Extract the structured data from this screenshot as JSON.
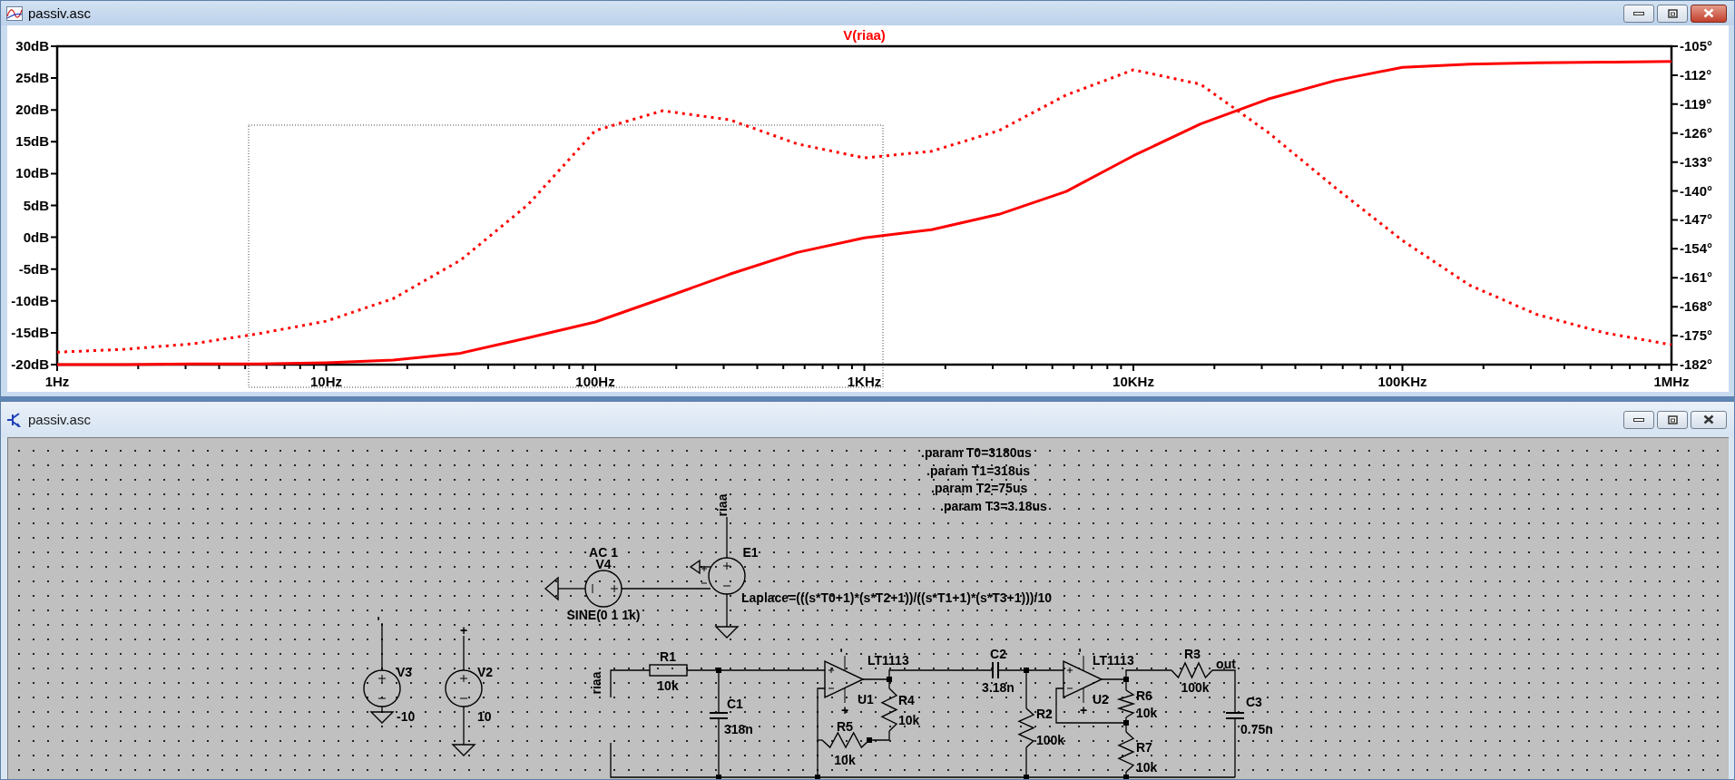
{
  "windows": [
    {
      "kind": "waveform",
      "title": "passiv.asc",
      "active": true,
      "plot": {
        "chart_data": {
          "type": "line",
          "title": "V(riaa)",
          "categories": [
            "1Hz",
            null,
            null,
            null,
            "10Hz",
            null,
            null,
            null,
            "100Hz",
            null,
            null,
            null,
            "1KHz",
            null,
            null,
            null,
            "10KHz",
            null,
            null,
            null,
            "100KHz",
            null,
            null,
            null,
            "1MHz"
          ],
          "ylim": [
            -20,
            30
          ],
          "y2lim": [
            -182,
            -105
          ],
          "yticks": [
            {
              "value": 30,
              "label": "30dB"
            },
            {
              "value": 25,
              "label": "25dB"
            },
            {
              "value": 20,
              "label": "20dB"
            },
            {
              "value": 15,
              "label": "15dB"
            },
            {
              "value": 10,
              "label": "10dB"
            },
            {
              "value": 5,
              "label": "5dB"
            },
            {
              "value": 0,
              "label": "0dB"
            },
            {
              "value": -5,
              "label": "-5dB"
            },
            {
              "value": -10,
              "label": "-10dB"
            },
            {
              "value": -15,
              "label": "-15dB"
            },
            {
              "value": -20,
              "label": "-20dB"
            }
          ],
          "y2ticks": [
            {
              "value": -105,
              "label": "-105°"
            },
            {
              "value": -112,
              "label": "-112°"
            },
            {
              "value": -119,
              "label": "-119°"
            },
            {
              "value": -126,
              "label": "-126°"
            },
            {
              "value": -133,
              "label": "-133°"
            },
            {
              "value": -140,
              "label": "-140°"
            },
            {
              "value": -147,
              "label": "-147°"
            },
            {
              "value": -154,
              "label": "-154°"
            },
            {
              "value": -161,
              "label": "-161°"
            },
            {
              "value": -168,
              "label": "-168°"
            },
            {
              "value": -175,
              "label": "-175°"
            },
            {
              "value": -182,
              "label": "-182°"
            }
          ],
          "series": [
            {
              "color": "#ff0000",
              "line_style": "solid",
              "values": [
                -20,
                -20,
                -19.9,
                -19.9,
                -19.7,
                -19.3,
                -18.2,
                -15.8,
                -13.3,
                -9.6,
                -5.8,
                -2.4,
                -0.1,
                1.2,
                3.6,
                7.2,
                12.8,
                17.8,
                21.7,
                24.6,
                26.7,
                27.2,
                27.4,
                27.5,
                27.6
              ]
            },
            {
              "axis": "y2",
              "color": "#ff0000",
              "line_style": "dotted",
              "values": [
                -179,
                -178.3,
                -177,
                -174.5,
                -171.5,
                -166,
                -156.7,
                -143.3,
                -125.4,
                -120.6,
                -122.8,
                -128.6,
                -132,
                -130.4,
                -125.4,
                -116.8,
                -110.7,
                -114.2,
                -125.8,
                -139.2,
                -152,
                -162.8,
                -169.9,
                -174.3,
                -177.2
              ]
            }
          ]
        }
      }
    },
    {
      "kind": "schematic",
      "title": "passiv.asc",
      "active": false,
      "schematic": {
        "directives": [
          ".param T0=3180us",
          ".param T1=318us",
          ".param T2=75us",
          ".param T3=3.18us"
        ],
        "components": [
          {
            "kind": "voltage_source",
            "ref": "V4",
            "value": "SINE(0 1 1k)",
            "extra": "AC 1"
          },
          {
            "kind": "dependent_source",
            "ref": "E1",
            "value": "Laplace=(((s*T0+1)*(s*T2+1))/((s*T1+1)*(s*T3+1)))/10"
          },
          {
            "kind": "voltage_source",
            "ref": "V3",
            "value": "-10"
          },
          {
            "kind": "voltage_source",
            "ref": "V2",
            "value": "10"
          },
          {
            "kind": "resistor",
            "ref": "R1",
            "value": "10k"
          },
          {
            "kind": "capacitor",
            "ref": "C1",
            "value": "318n"
          },
          {
            "kind": "opamp",
            "ref": "U1",
            "value": "LT1113"
          },
          {
            "kind": "resistor",
            "ref": "R4",
            "value": "10k"
          },
          {
            "kind": "resistor",
            "ref": "R5",
            "value": "10k"
          },
          {
            "kind": "capacitor",
            "ref": "C2",
            "value": "3.18n"
          },
          {
            "kind": "resistor",
            "ref": "R2",
            "value": "100k"
          },
          {
            "kind": "opamp",
            "ref": "U2",
            "value": "LT1113"
          },
          {
            "kind": "resistor",
            "ref": "R6",
            "value": "10k"
          },
          {
            "kind": "resistor",
            "ref": "R7",
            "value": "10k"
          },
          {
            "kind": "resistor",
            "ref": "R3",
            "value": "100k"
          },
          {
            "kind": "capacitor",
            "ref": "C3",
            "value": "0.75n"
          }
        ],
        "net_labels": [
          "riaa",
          "riaa",
          "out",
          "-",
          "+",
          "-",
          "+",
          "-",
          "+"
        ]
      }
    }
  ]
}
